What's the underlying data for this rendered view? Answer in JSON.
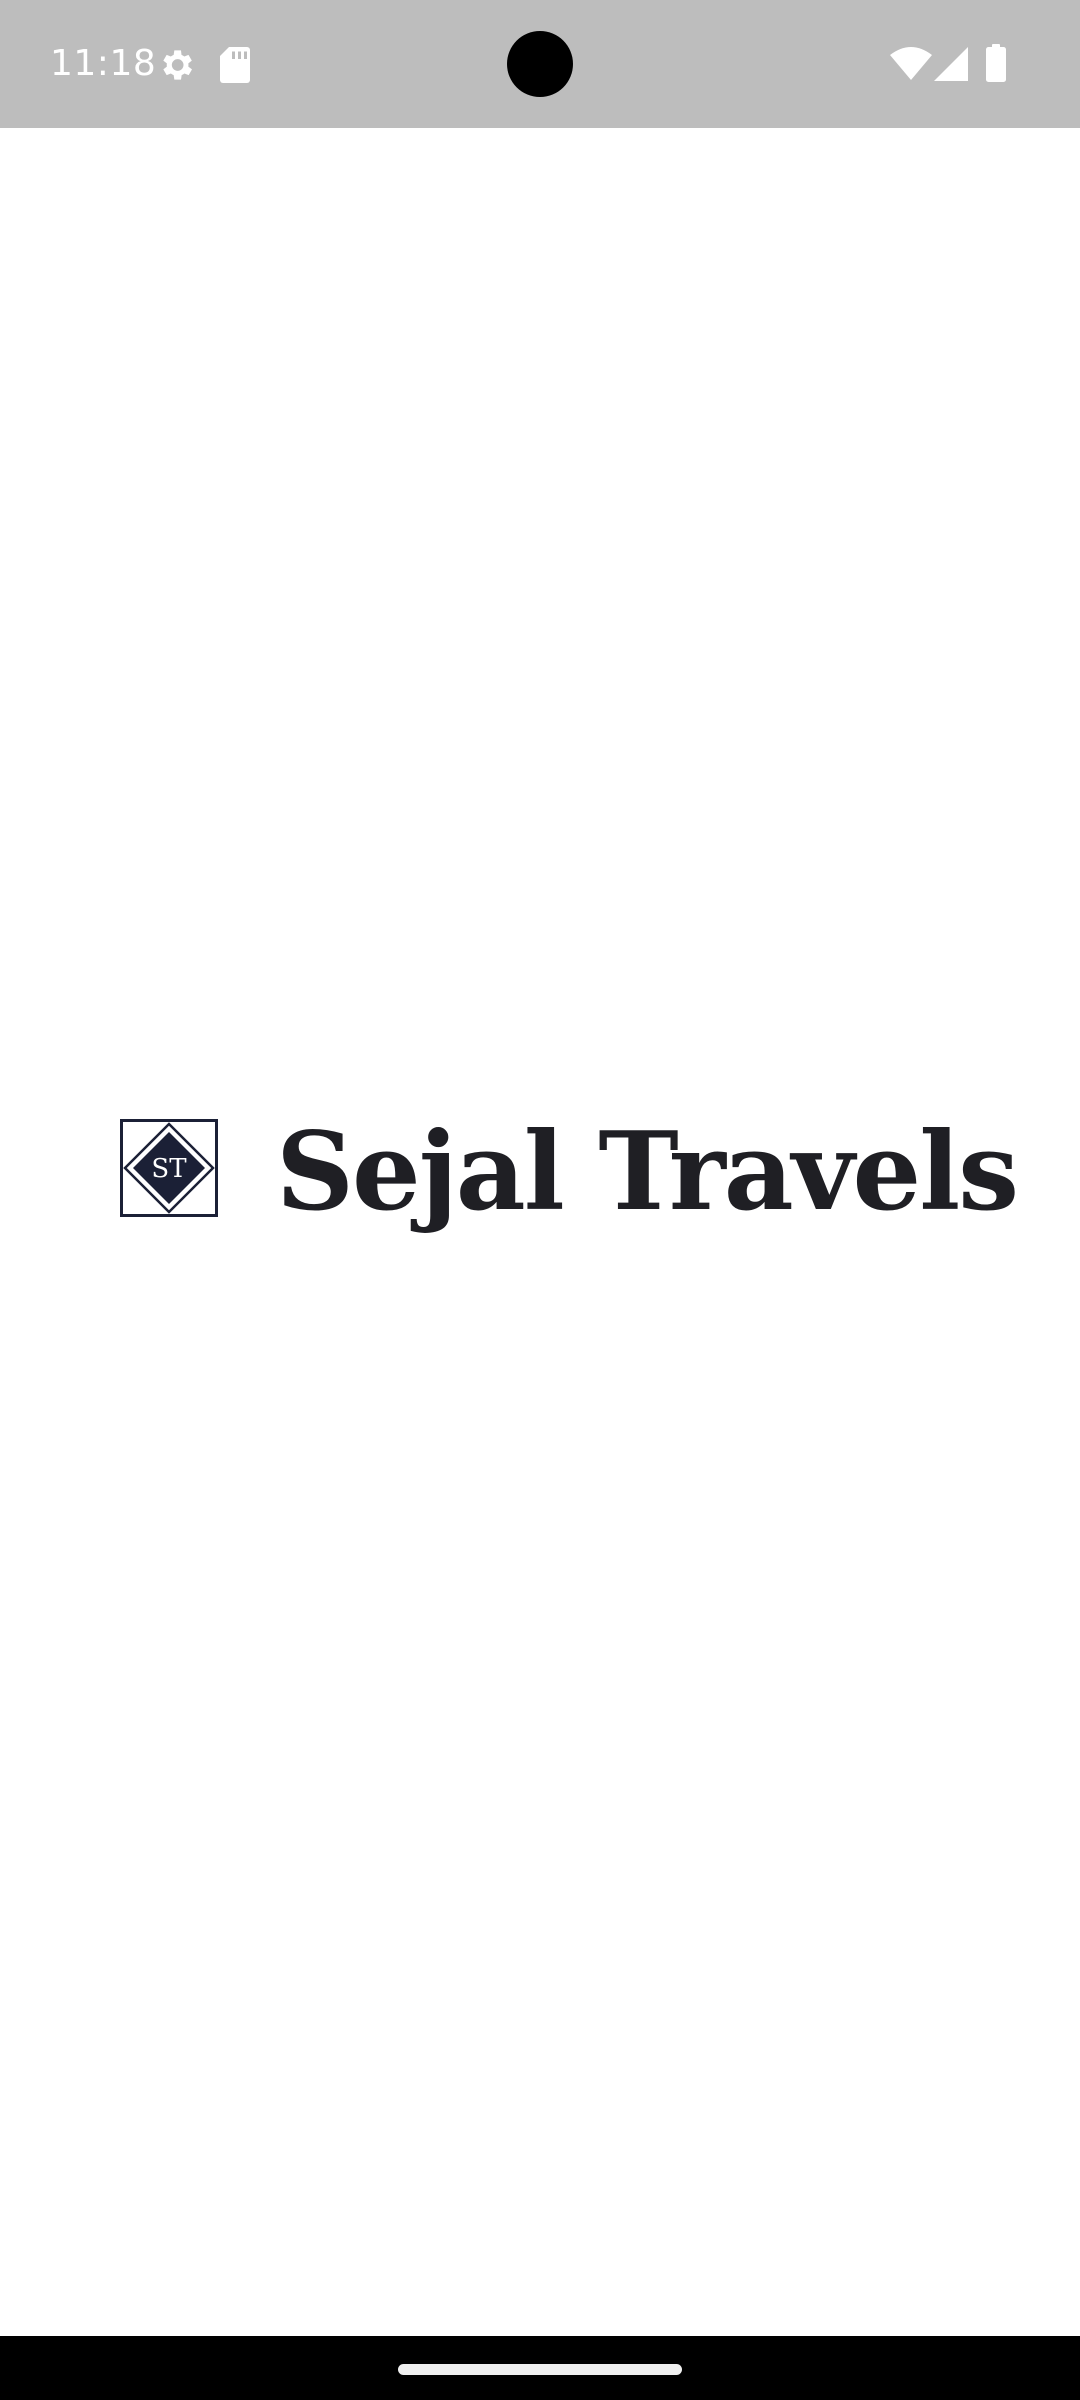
{
  "status_bar": {
    "time": "11:18",
    "icons": [
      "settings-icon",
      "sd-card-icon",
      "wifi-icon",
      "cell-signal-icon",
      "battery-icon"
    ],
    "background": "#bdbdbd"
  },
  "splash": {
    "logo_monogram": "ST",
    "app_name": "Sejal Travels",
    "brand_color": "#1b2036",
    "text_color": "#1f1f24"
  },
  "navigation": {
    "handle": "home-gesture-handle"
  }
}
